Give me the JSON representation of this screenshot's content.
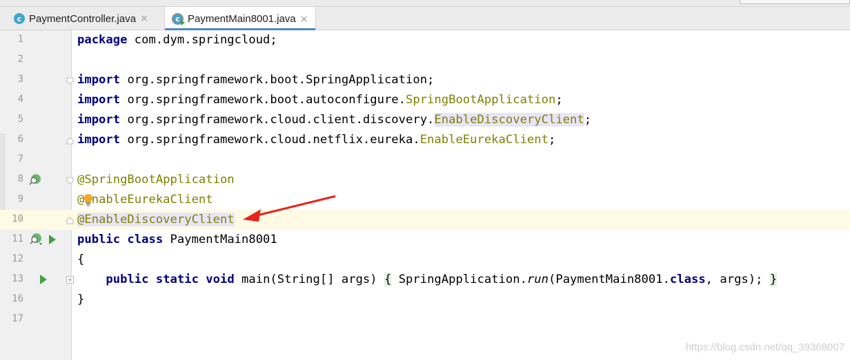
{
  "tabs": [
    {
      "label": "PaymentController.java",
      "icon": "class-icon",
      "icon_letter": "c",
      "close": "×",
      "active": false
    },
    {
      "label": "PaymentMain8001.java",
      "icon": "spring-main-class-icon",
      "icon_letter": "c",
      "close": "×",
      "active": true
    }
  ],
  "editor": {
    "current_line": "10",
    "lines": [
      {
        "num": "1"
      },
      {
        "num": "2"
      },
      {
        "num": "3"
      },
      {
        "num": "4"
      },
      {
        "num": "5"
      },
      {
        "num": "6"
      },
      {
        "num": "7"
      },
      {
        "num": "8"
      },
      {
        "num": "9"
      },
      {
        "num": "10"
      },
      {
        "num": "11"
      },
      {
        "num": "12"
      },
      {
        "num": "13"
      },
      {
        "num": "16"
      },
      {
        "num": "17"
      }
    ],
    "code": {
      "l1_kw": "package",
      "l1_rest": " com.dym.springcloud;",
      "l3_kw": "import",
      "l3_rest": " org.springframework.boot.SpringApplication;",
      "l4_kw": "import",
      "l4_pkg": " org.springframework.boot.autoconfigure.",
      "l4_cls": "SpringBootApplication",
      "l4_end": ";",
      "l5_kw": "import",
      "l5_pkg": " org.springframework.cloud.client.discovery.",
      "l5_cls": "EnableDiscoveryClient",
      "l5_end": ";",
      "l6_kw": "import",
      "l6_pkg": " org.springframework.cloud.netflix.eureka.",
      "l6_cls": "EnableEurekaClient",
      "l6_end": ";",
      "l8_anno": "@SpringBootApplication",
      "l9_anno": "@EnableEurekaClient",
      "l10_anno": "@EnableDiscoveryClient",
      "l11_kw": "public class",
      "l11_rest": " PaymentMain8001",
      "l12": "{",
      "l13_indent": "    ",
      "l13_kw": "public static void",
      "l13_mid": " main(String[] args) ",
      "l13_open": "{",
      "l13_call1": " SpringApplication.",
      "l13_run": "run",
      "l13_call2": "(PaymentMain8001.",
      "l13_class": "class",
      "l13_call3": ", args); ",
      "l13_close": "}",
      "l16": "}"
    }
  },
  "annotation": {
    "arrow_color": "#e8231b"
  },
  "watermark": "https://blog.csdn.net/qq_39368007",
  "colors": {
    "keyword": "#000080",
    "annotation": "#808000",
    "current_line": "#fffae3",
    "usage_highlight": "#e7e5f6",
    "accent_tab": "#4a88c7",
    "run_icon": "#3fa33f"
  }
}
